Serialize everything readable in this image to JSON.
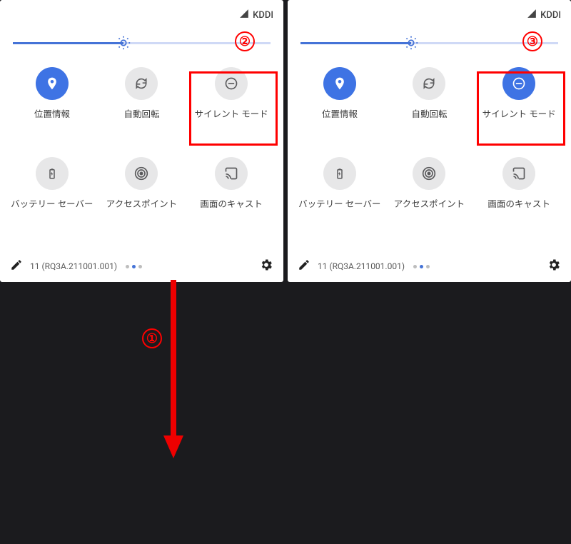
{
  "status": {
    "carrier": "KDDI"
  },
  "tiles": {
    "location": "位置情報",
    "rotate": "自動回転",
    "silent": "サイレント モード",
    "battery": "バッテリー セーバー",
    "hotspot": "アクセスポイント",
    "cast": "画面のキャスト"
  },
  "footer": {
    "build": "11 (RQ3A.211001.001)"
  },
  "annotations": {
    "step1": "①",
    "step2": "②",
    "step3": "③"
  }
}
